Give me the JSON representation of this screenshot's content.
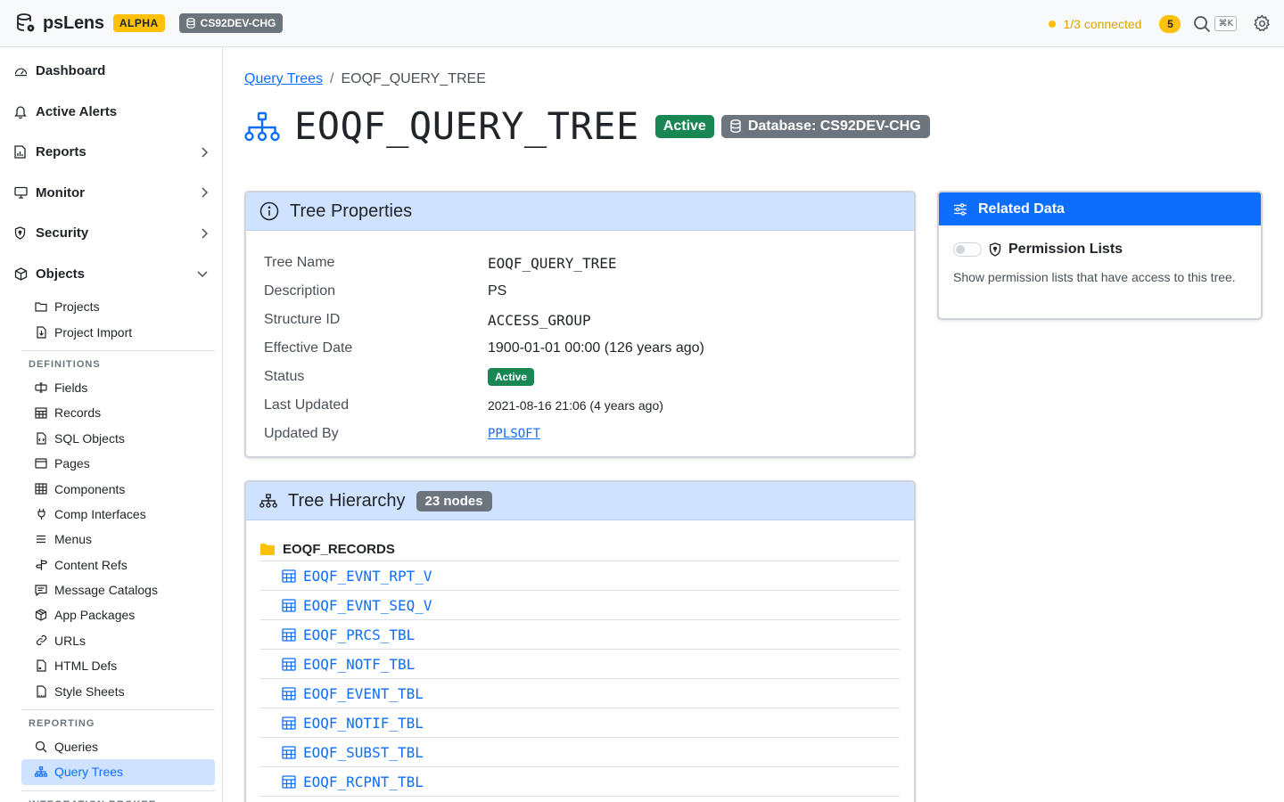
{
  "app": {
    "name": "psLens",
    "stage_badge": "ALPHA",
    "database_chip": "CS92DEV-CHG",
    "connection_status": "1/3 connected",
    "alert_count": "5",
    "shortcut_hint": "⌘K",
    "colors": {
      "accent": "#0d6efd",
      "warning": "#ffc107",
      "success": "#198754",
      "muted": "#6c757d",
      "header_bg": "#cfe2ff"
    }
  },
  "sidebar": {
    "main": [
      {
        "label": "Dashboard",
        "icon": "speedometer-icon"
      },
      {
        "label": "Active Alerts",
        "icon": "bell-icon"
      },
      {
        "label": "Reports",
        "icon": "chart-file-icon",
        "chevron": "right"
      },
      {
        "label": "Monitor",
        "icon": "display-icon",
        "chevron": "right"
      },
      {
        "label": "Security",
        "icon": "shield-icon",
        "chevron": "right"
      },
      {
        "label": "Objects",
        "icon": "box-icon",
        "chevron": "down"
      }
    ],
    "objects_items": [
      {
        "label": "Projects",
        "icon": "folder-icon"
      },
      {
        "label": "Project Import",
        "icon": "file-import-icon"
      }
    ],
    "definitions_heading": "DEFINITIONS",
    "definitions_items": [
      {
        "label": "Fields",
        "icon": "input-cursor-icon"
      },
      {
        "label": "Records",
        "icon": "table-icon"
      },
      {
        "label": "SQL Objects",
        "icon": "file-code-icon"
      },
      {
        "label": "Pages",
        "icon": "window-icon"
      },
      {
        "label": "Components",
        "icon": "grid-icon"
      },
      {
        "label": "Comp Interfaces",
        "icon": "plug-icon"
      },
      {
        "label": "Menus",
        "icon": "list-icon"
      },
      {
        "label": "Content Refs",
        "icon": "signpost-icon"
      },
      {
        "label": "Message Catalogs",
        "icon": "chat-text-icon"
      },
      {
        "label": "App Packages",
        "icon": "package-icon"
      },
      {
        "label": "URLs",
        "icon": "link-icon"
      },
      {
        "label": "HTML Defs",
        "icon": "file-html-icon"
      },
      {
        "label": "Style Sheets",
        "icon": "file-css-icon"
      }
    ],
    "reporting_heading": "REPORTING",
    "reporting_items": [
      {
        "label": "Queries",
        "icon": "search-icon"
      },
      {
        "label": "Query Trees",
        "icon": "diagram-icon",
        "active": true
      }
    ],
    "integration_heading": "INTEGRATION BROKER"
  },
  "breadcrumb": {
    "parent": "Query Trees",
    "separator": "/",
    "current": "EOQF_QUERY_TREE"
  },
  "page": {
    "title": "EOQF_QUERY_TREE",
    "status_badge": "Active",
    "database_badge": "Database: CS92DEV-CHG"
  },
  "properties": {
    "title": "Tree Properties",
    "rows": [
      {
        "key": "Tree Name",
        "value": "EOQF_QUERY_TREE"
      },
      {
        "key": "Description",
        "value": "PS"
      },
      {
        "key": "Structure ID",
        "value": "ACCESS_GROUP"
      },
      {
        "key": "Effective Date",
        "value": "1900-01-01 00:00 (126 years ago)"
      },
      {
        "key": "Status",
        "value": "Active"
      },
      {
        "key": "Last Updated",
        "value": "2021-08-16 21:06 (4 years ago)"
      },
      {
        "key": "Updated By",
        "value": "PPLSOFT"
      }
    ]
  },
  "hierarchy": {
    "title": "Tree Hierarchy",
    "count_badge": "23 nodes",
    "root": "EOQF_RECORDS",
    "nodes": [
      "EOQF_EVNT_RPT_V",
      "EOQF_EVNT_SEQ_V",
      "EOQF_PRCS_TBL",
      "EOQF_NOTF_TBL",
      "EOQF_EVENT_TBL",
      "EOQF_NOTIF_TBL",
      "EOQF_SUBST_TBL",
      "EOQF_RCPNT_TBL"
    ]
  },
  "related": {
    "title": "Related Data",
    "permission_title": "Permission Lists",
    "permission_desc": "Show permission lists that have access to this tree.",
    "toggle_on": false
  }
}
